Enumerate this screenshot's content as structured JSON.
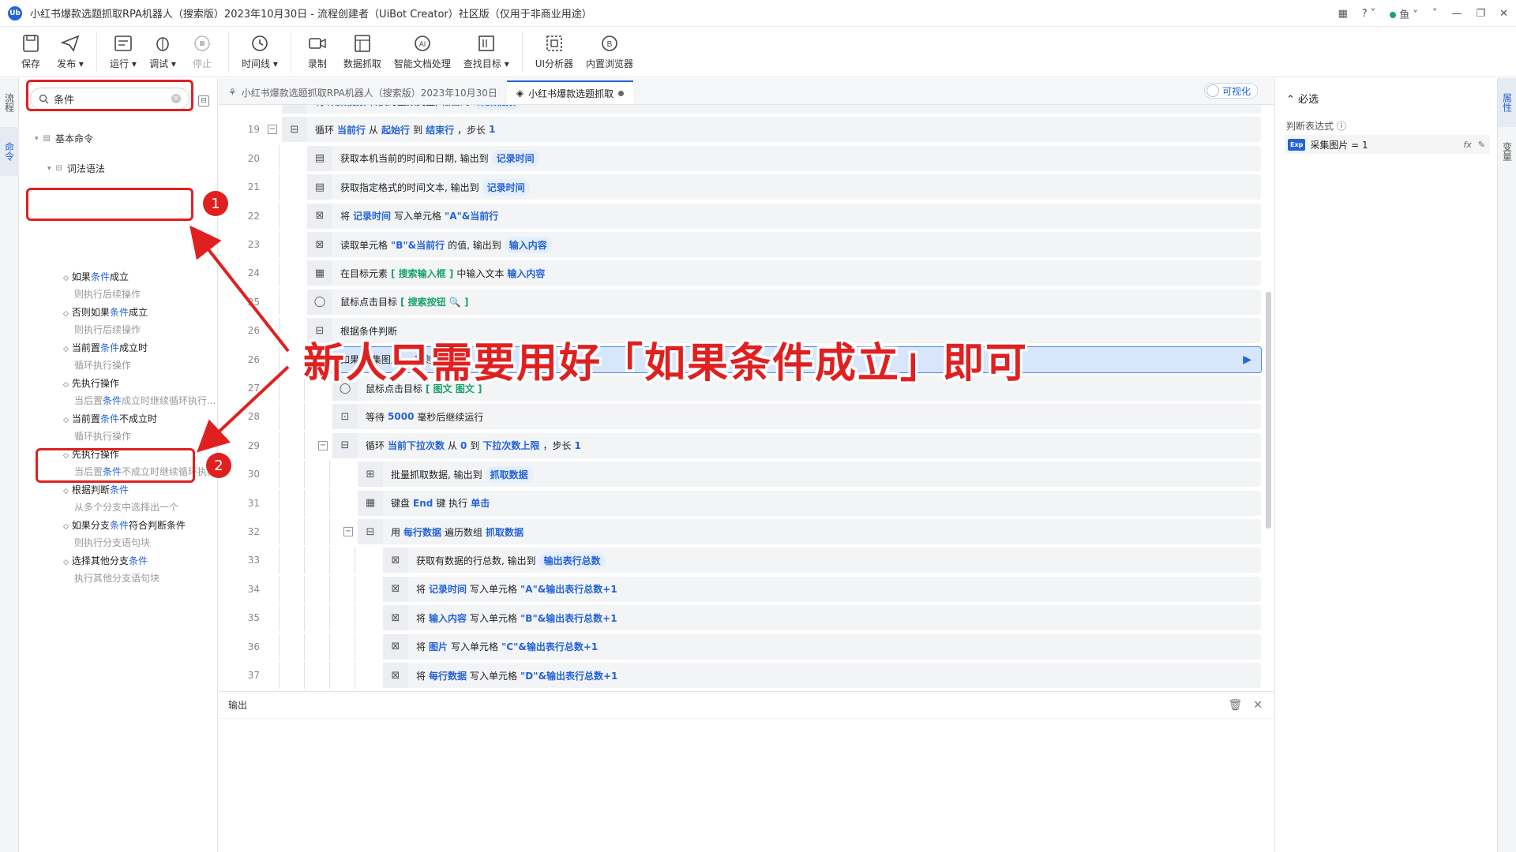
{
  "app": {
    "title": "小红书爆款选题抓取RPA机器人（搜索版）2023年10月30日 - 流程创建者（UiBot Creator）社区版（仅用于非商业用途）",
    "logo": "Ub",
    "user": "鱼"
  },
  "toolbar": {
    "groups": [
      [
        {
          "label": "保存",
          "icon": "save-icon"
        },
        {
          "label": "发布 ▾",
          "icon": "publish-icon"
        }
      ],
      [
        {
          "label": "运行 ▾",
          "icon": "run-icon"
        },
        {
          "label": "调试 ▾",
          "icon": "debug-icon"
        },
        {
          "label": "停止",
          "icon": "stop-icon",
          "disabled": true
        }
      ],
      [
        {
          "label": "时间线 ▾",
          "icon": "timeline-icon"
        }
      ],
      [
        {
          "label": "录制",
          "icon": "record-icon"
        },
        {
          "label": "数据抓取",
          "icon": "data-scrape-icon"
        },
        {
          "label": "智能文档处理",
          "icon": "ai-doc-icon"
        },
        {
          "label": "查找目标 ▾",
          "icon": "find-target-icon"
        }
      ],
      [
        {
          "label": "UI分析器",
          "icon": "ui-analyzer-icon"
        },
        {
          "label": "内置浏览器",
          "icon": "browser-icon"
        }
      ]
    ]
  },
  "leftrail": {
    "tabs": [
      "流程",
      "命令"
    ]
  },
  "rightrail": {
    "tabs": [
      "属性",
      "变量"
    ]
  },
  "sidebar": {
    "search_value": "条件",
    "root": "基本命令",
    "group": "词法语法",
    "commands": [
      {
        "pre": "如果",
        "hl": "条件",
        "post": "成立",
        "desc": "则执行后续操作"
      },
      {
        "pre": "否则如果",
        "hl": "条件",
        "post": "成立",
        "desc": "则执行后续操作"
      },
      {
        "pre": "当前置",
        "hl": "条件",
        "post": "成立时",
        "desc": "循环执行操作"
      },
      {
        "pre": "先执行操作",
        "hl": "",
        "post": "",
        "desc_pre": "当后置",
        "desc_hl": "条件",
        "desc": "成立时继续循环执行..."
      },
      {
        "pre": "当前置",
        "hl": "条件",
        "post": "不成立时",
        "desc": "循环执行操作"
      },
      {
        "pre": "先执行操作",
        "hl": "",
        "post": "",
        "desc_pre": "当后置",
        "desc_hl": "条件",
        "desc": "不成立时继续循环执行"
      },
      {
        "pre": "根据判断",
        "hl": "条件",
        "post": "",
        "desc": "从多个分支中选择出一个"
      },
      {
        "pre": "如果分支",
        "hl": "条件",
        "post": "符合判断条件",
        "desc": "则执行分支语句块"
      },
      {
        "pre": "选择其他分支",
        "hl": "条件",
        "post": "",
        "desc": "执行其他分支语句块"
      }
    ]
  },
  "annotations": {
    "badge1": "1",
    "badge2": "2",
    "callout": "新人只需要用好「如果条件成立」即可"
  },
  "tabs": [
    {
      "label": "小红书爆款选题抓取RPA机器人（搜索版）2023年10月30日",
      "icon": "flow-icon"
    },
    {
      "label": "小红书爆款选题抓取",
      "icon": "layers-icon",
      "active": true
    }
  ],
  "viz_toggle": "可视化",
  "code_lines": [
    {
      "n": "18",
      "indent": 0,
      "segs": [
        [
          "t",
          "将 "
        ],
        [
          "v",
          "采集视频"
        ],
        [
          "t",
          " 转换为整数类型, 输出到 "
        ],
        [
          "p",
          "采集视频"
        ]
      ]
    },
    {
      "n": "19",
      "indent": 0,
      "fold": true,
      "segs": [
        [
          "t",
          "循环 "
        ],
        [
          "v",
          "当前行"
        ],
        [
          "t",
          " 从 "
        ],
        [
          "v",
          "起始行"
        ],
        [
          "t",
          " 到 "
        ],
        [
          "v",
          "结束行"
        ],
        [
          "t",
          " ，步长 "
        ],
        [
          "v",
          "1"
        ]
      ]
    },
    {
      "n": "20",
      "indent": 1,
      "segs": [
        [
          "t",
          "获取本机当前的时间和日期, 输出到 "
        ],
        [
          "p",
          "记录时间"
        ]
      ]
    },
    {
      "n": "21",
      "indent": 1,
      "segs": [
        [
          "t",
          "获取指定格式的时间文本, 输出到 "
        ],
        [
          "p",
          "记录时间"
        ]
      ]
    },
    {
      "n": "22",
      "indent": 1,
      "segs": [
        [
          "t",
          "将 "
        ],
        [
          "v",
          "记录时间"
        ],
        [
          "t",
          " 写入单元格 "
        ],
        [
          "s",
          "\"A\"&当前行"
        ]
      ]
    },
    {
      "n": "23",
      "indent": 1,
      "segs": [
        [
          "t",
          "读取单元格 "
        ],
        [
          "s",
          "\"B\"&当前行"
        ],
        [
          "t",
          " 的值, 输出到 "
        ],
        [
          "p",
          "输入内容"
        ]
      ]
    },
    {
      "n": "24",
      "indent": 1,
      "segs": [
        [
          "t",
          "在目标元素 "
        ],
        [
          "g",
          "[ 搜索输入框          ]"
        ],
        [
          "t",
          " 中输入文本 "
        ],
        [
          "v",
          "输入内容"
        ]
      ]
    },
    {
      "n": "25",
      "indent": 1,
      "segs": [
        [
          "t",
          "鼠标点击目标 "
        ],
        [
          "g",
          "[ 搜索按钮  🔍  ]"
        ]
      ]
    },
    {
      "n": "26",
      "indent": 1,
      "segs": [
        [
          "t",
          "根据条件判断"
        ]
      ]
    },
    {
      "n": "26",
      "indent": 1,
      "selected": true,
      "segs": [
        [
          "t",
          "如果 采集图片 = 1 则"
        ]
      ]
    },
    {
      "n": "27",
      "indent": 2,
      "segs": [
        [
          "t",
          "鼠标点击目标 "
        ],
        [
          "g",
          "[ 图文   图文   ]"
        ]
      ]
    },
    {
      "n": "28",
      "indent": 2,
      "segs": [
        [
          "t",
          "等待 "
        ],
        [
          "v",
          "5000"
        ],
        [
          "t",
          " 毫秒后继续运行"
        ]
      ]
    },
    {
      "n": "29",
      "indent": 2,
      "fold": true,
      "segs": [
        [
          "t",
          "循环 "
        ],
        [
          "v",
          "当前下拉次数"
        ],
        [
          "t",
          " 从 "
        ],
        [
          "v",
          "0"
        ],
        [
          "t",
          " 到 "
        ],
        [
          "v",
          "下拉次数上限"
        ],
        [
          "t",
          " ，步长 "
        ],
        [
          "v",
          "1"
        ]
      ]
    },
    {
      "n": "30",
      "indent": 3,
      "segs": [
        [
          "t",
          "批量抓取数据, 输出到 "
        ],
        [
          "p",
          "抓取数据"
        ]
      ]
    },
    {
      "n": "31",
      "indent": 3,
      "segs": [
        [
          "t",
          "键盘 "
        ],
        [
          "v",
          "End"
        ],
        [
          "t",
          " 键 执行 "
        ],
        [
          "v",
          "单击"
        ]
      ]
    },
    {
      "n": "32",
      "indent": 3,
      "fold": true,
      "segs": [
        [
          "t",
          "用 "
        ],
        [
          "v",
          "每行数据"
        ],
        [
          "t",
          " 遍历数组 "
        ],
        [
          "v",
          "抓取数据"
        ]
      ]
    },
    {
      "n": "33",
      "indent": 4,
      "segs": [
        [
          "t",
          "获取有数据的行总数, 输出到 "
        ],
        [
          "p",
          "输出表行总数"
        ]
      ]
    },
    {
      "n": "34",
      "indent": 4,
      "segs": [
        [
          "t",
          "将 "
        ],
        [
          "v",
          "记录时间"
        ],
        [
          "t",
          " 写入单元格 "
        ],
        [
          "s",
          "\"A\"&输出表行总数+1"
        ]
      ]
    },
    {
      "n": "35",
      "indent": 4,
      "segs": [
        [
          "t",
          "将 "
        ],
        [
          "v",
          "输入内容"
        ],
        [
          "t",
          " 写入单元格 "
        ],
        [
          "s",
          "\"B\"&输出表行总数+1"
        ]
      ]
    },
    {
      "n": "36",
      "indent": 4,
      "segs": [
        [
          "t",
          "将 "
        ],
        [
          "v",
          "图片"
        ],
        [
          "t",
          " 写入单元格 "
        ],
        [
          "s",
          "\"C\"&输出表行总数+1"
        ]
      ]
    },
    {
      "n": "37",
      "indent": 4,
      "segs": [
        [
          "t",
          "将 "
        ],
        [
          "v",
          "每行数据"
        ],
        [
          "t",
          " 写入单元格 "
        ],
        [
          "s",
          "\"D\"&输出表行总数+1"
        ]
      ]
    }
  ],
  "output": {
    "title": "输出"
  },
  "rightpanel": {
    "section": "必选",
    "label": "判断表达式",
    "exp_tag": "Exp",
    "expression": "采集图片 = 1",
    "fx": "fx"
  }
}
